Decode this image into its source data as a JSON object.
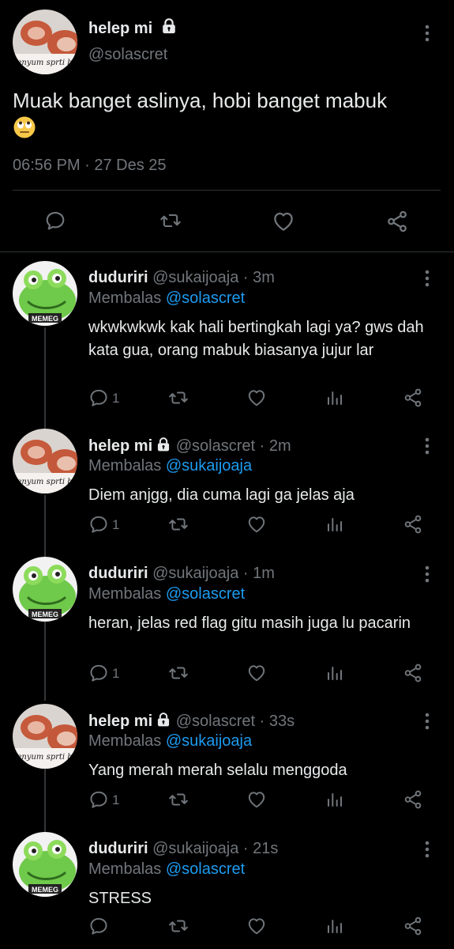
{
  "main_tweet": {
    "display_name": "helep mi",
    "handle": "@solascret",
    "avatar_caption": "senyum sprti ba",
    "text": "Muak banget aslinya, hobi banget mabuk",
    "emoji": "eye-roll-emoji",
    "timestamp": "06:56 PM · 27 Des 25",
    "actions": [
      "reply-icon",
      "retweet-icon",
      "like-icon",
      "share-icon"
    ]
  },
  "replies": [
    {
      "display_name": "duduriri",
      "handle": "@sukaijoaja",
      "time": "· 3m",
      "replying_label": "Membalas",
      "replying_to": "@solascret",
      "text": "wkwkwkwk kak hali bertingkah lagi ya? gws dah kata gua, orang mabuk biasanya jujur lar",
      "reply_count": "1",
      "avatar_caption": "MEMEG"
    },
    {
      "display_name": "helep mi",
      "handle": "@solascret",
      "time": "· 2m",
      "replying_label": "Membalas",
      "replying_to": "@sukaijoaja",
      "text": "Diem anjgg, dia cuma lagi ga jelas aja",
      "reply_count": "1",
      "avatar_caption": "senyum sprti ba"
    },
    {
      "display_name": "duduriri",
      "handle": "@sukaijoaja",
      "time": "· 1m",
      "replying_label": "Membalas",
      "replying_to": "@solascret",
      "text": "heran, jelas red flag gitu masih juga lu pacarin",
      "reply_count": "1",
      "avatar_caption": "MEMEG"
    },
    {
      "display_name": "helep mi",
      "handle": "@solascret",
      "time": "· 33s",
      "replying_label": "Membalas",
      "replying_to": "@sukaijoaja",
      "text": "Yang merah merah selalu menggoda",
      "reply_count": "1",
      "avatar_caption": "senyum sprti ba"
    },
    {
      "display_name": "duduriri",
      "handle": "@sukaijoaja",
      "time": "· 21s",
      "replying_label": "Membalas",
      "replying_to": "@solascret",
      "text": "STRESS",
      "reply_count": "",
      "avatar_caption": "MEMEG"
    }
  ],
  "colors": {
    "background": "#000000",
    "text": "#e7e9ea",
    "muted": "#71767b",
    "link": "#1d9bf0",
    "divider": "#2f3336"
  }
}
